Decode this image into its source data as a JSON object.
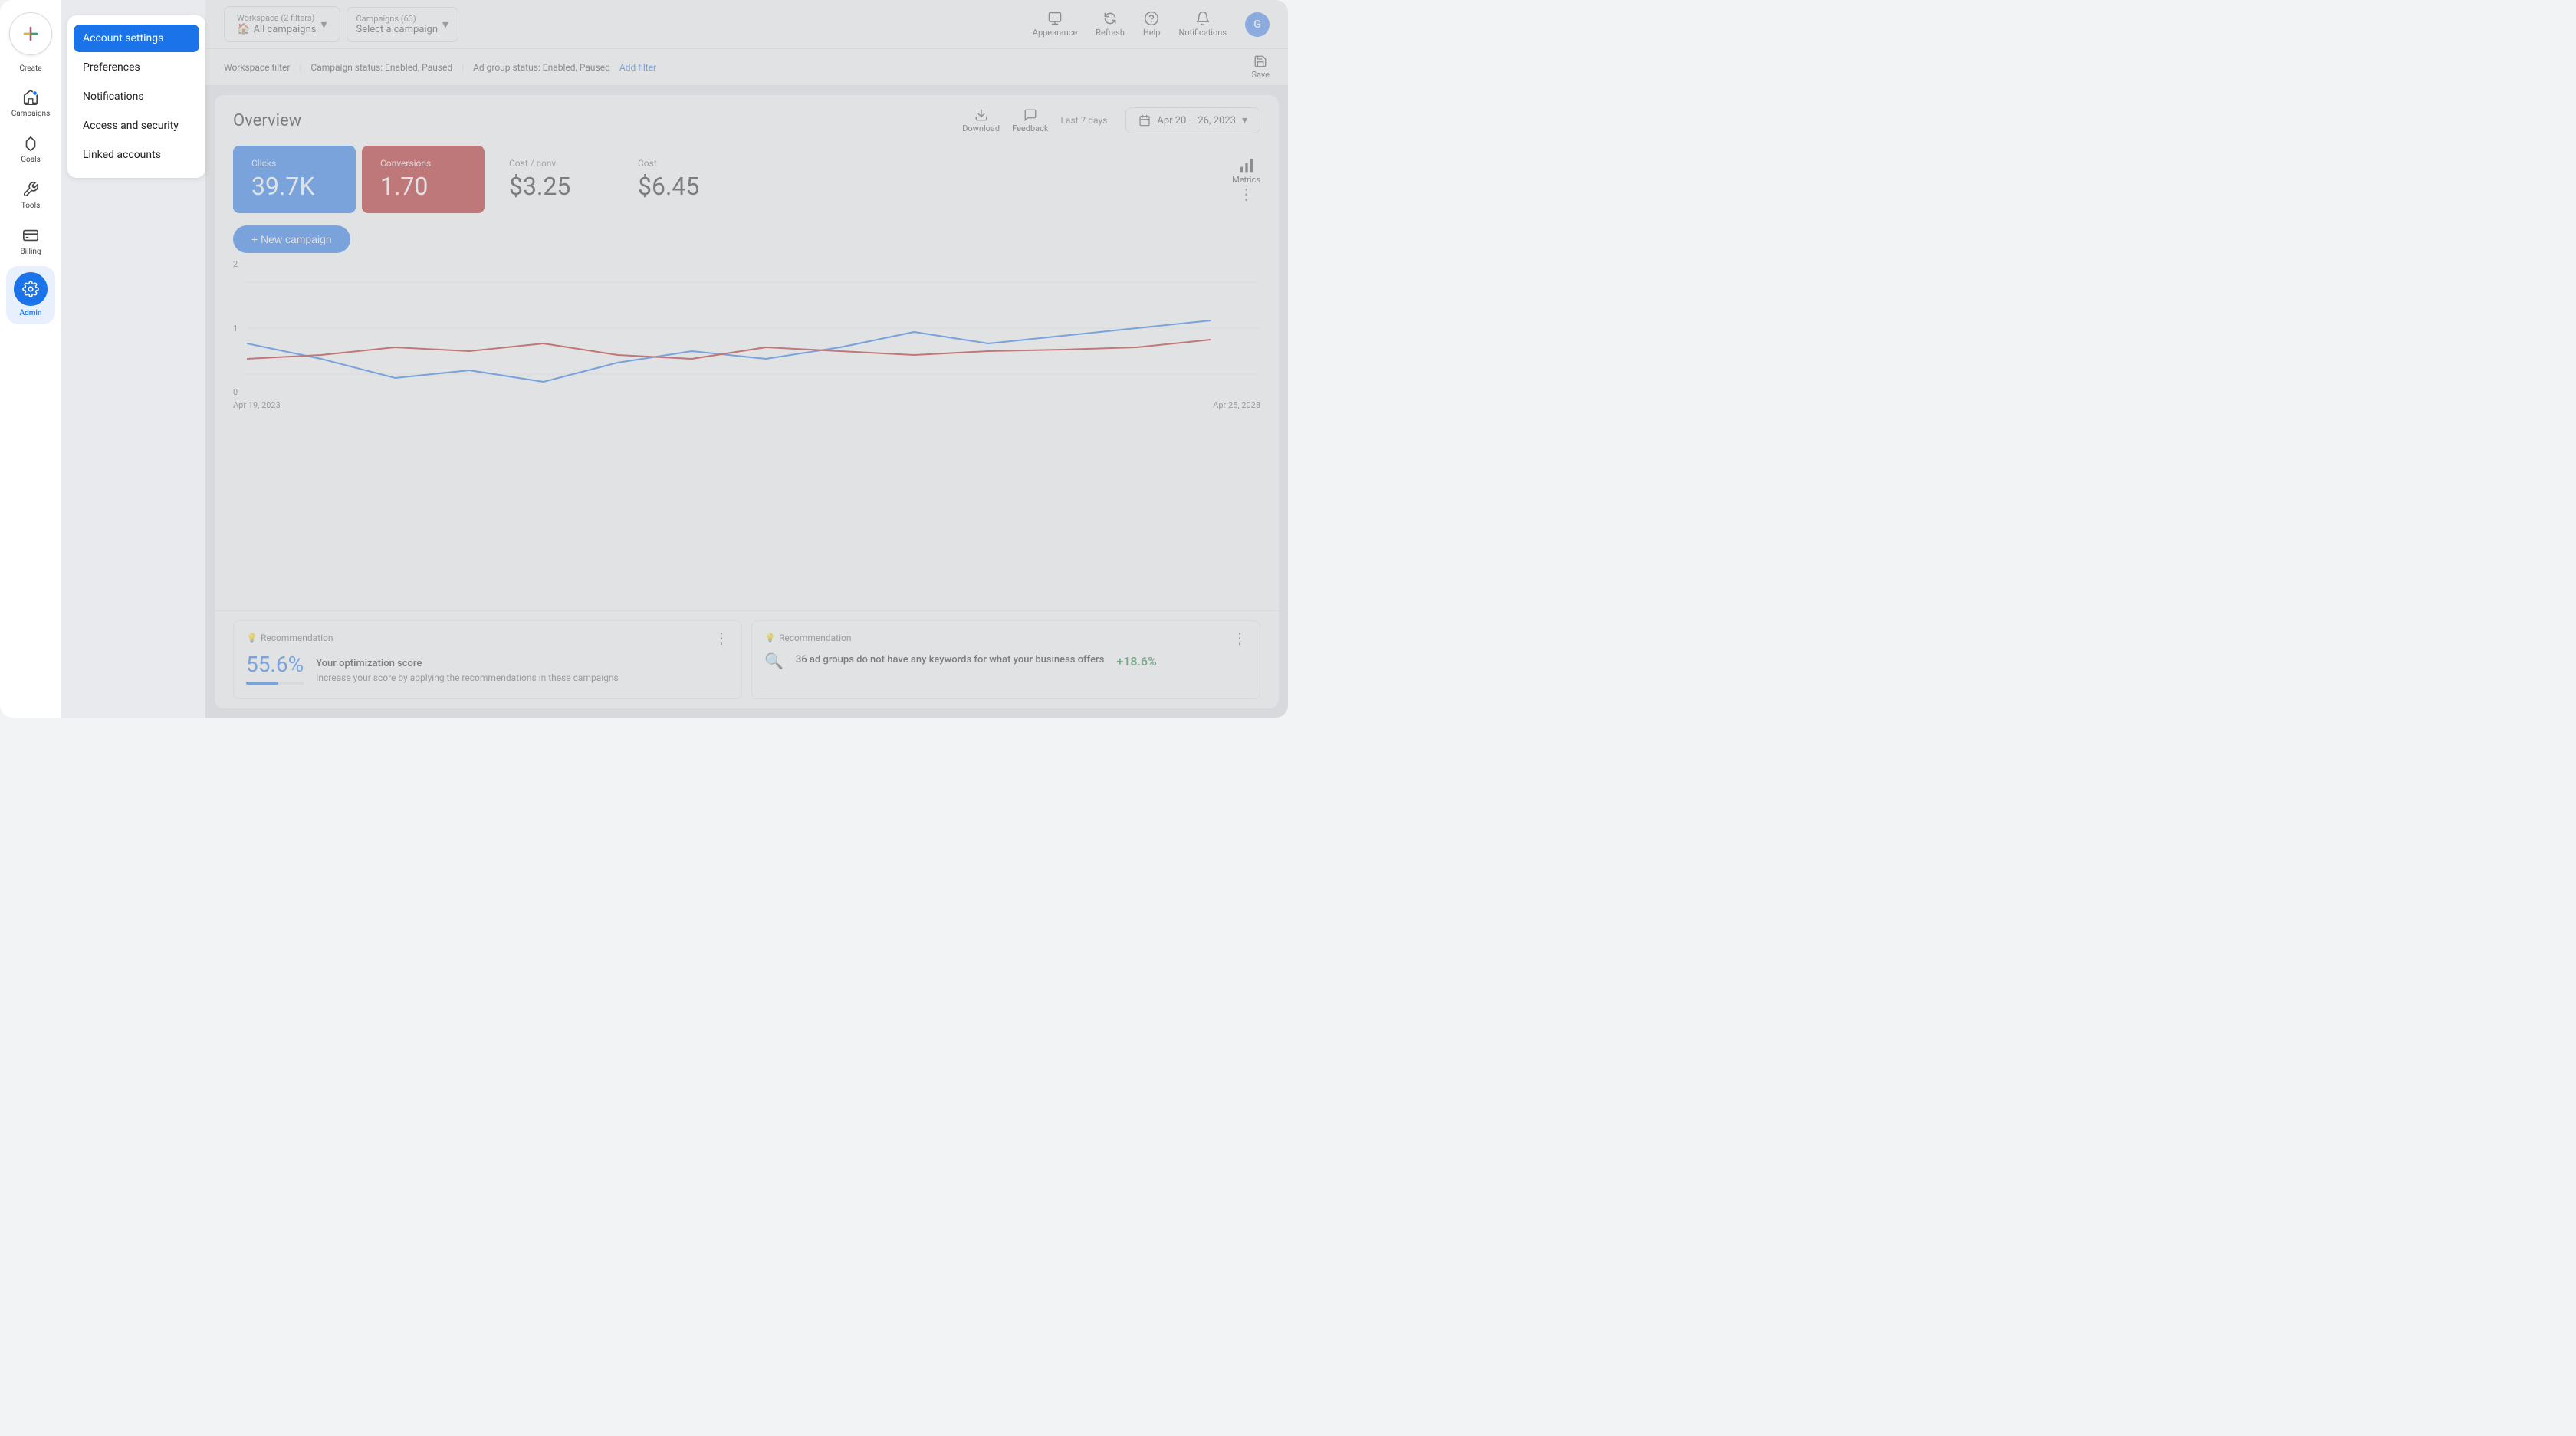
{
  "sidebar": {
    "create_label": "Create",
    "items": [
      {
        "id": "campaigns",
        "label": "Campaigns",
        "icon": "📢"
      },
      {
        "id": "goals",
        "label": "Goals",
        "icon": "🏆"
      },
      {
        "id": "tools",
        "label": "Tools",
        "icon": "🔧"
      },
      {
        "id": "billing",
        "label": "Billing",
        "icon": "💳"
      },
      {
        "id": "admin",
        "label": "Admin",
        "icon": "⚙️",
        "active": true
      }
    ]
  },
  "account_menu": {
    "items": [
      {
        "id": "account-settings",
        "label": "Account settings",
        "active": true
      },
      {
        "id": "preferences",
        "label": "Preferences"
      },
      {
        "id": "notifications",
        "label": "Notifications"
      },
      {
        "id": "access-security",
        "label": "Access and security"
      },
      {
        "id": "linked-accounts",
        "label": "Linked accounts"
      }
    ]
  },
  "toolbar": {
    "workspace_label": "Workspace (2 filters)",
    "workspace_sub": "All campaigns",
    "campaigns_label": "Campaigns (63)",
    "campaigns_sub": "Select a campaign",
    "appearance_label": "Appearance",
    "refresh_label": "Refresh",
    "help_label": "Help",
    "notifications_label": "Notifications",
    "save_label": "Save"
  },
  "filters": {
    "items": [
      "Workspace filter",
      "Campaign status: Enabled, Paused",
      "Ad group status: Enabled, Paused"
    ],
    "add_label": "Add filter"
  },
  "overview": {
    "title": "Overview",
    "last_days_label": "Last 7 days",
    "date_range": "Apr 20 – 26, 2023",
    "new_campaign_label": "+ New campaign",
    "download_label": "Download",
    "feedback_label": "Feedback",
    "metrics_label": "Metrics"
  },
  "metric_cards": [
    {
      "id": "clicks",
      "label": "Clicks",
      "value": "39.7K",
      "type": "blue"
    },
    {
      "id": "conversions",
      "label": "Conversions",
      "value": "1.70",
      "type": "red"
    },
    {
      "id": "cost-conv",
      "label": "Cost / conv.",
      "value": "$3.25",
      "type": "plain"
    },
    {
      "id": "cost",
      "label": "Cost",
      "value": "$6.45",
      "type": "plain"
    }
  ],
  "chart": {
    "y_labels": [
      "2",
      "1",
      "0"
    ],
    "x_labels": [
      "Apr 19, 2023",
      "Apr 25, 2023"
    ],
    "blue_line": [
      [
        0,
        110
      ],
      [
        60,
        130
      ],
      [
        120,
        155
      ],
      [
        180,
        145
      ],
      [
        240,
        160
      ],
      [
        300,
        135
      ],
      [
        360,
        120
      ],
      [
        420,
        130
      ],
      [
        480,
        115
      ],
      [
        540,
        95
      ],
      [
        600,
        110
      ],
      [
        660,
        100
      ],
      [
        720,
        90
      ],
      [
        780,
        80
      ]
    ],
    "red_line": [
      [
        0,
        130
      ],
      [
        60,
        125
      ],
      [
        120,
        115
      ],
      [
        180,
        120
      ],
      [
        240,
        110
      ],
      [
        300,
        125
      ],
      [
        360,
        130
      ],
      [
        420,
        115
      ],
      [
        480,
        120
      ],
      [
        540,
        125
      ],
      [
        600,
        120
      ],
      [
        660,
        118
      ],
      [
        720,
        115
      ],
      [
        780,
        105
      ]
    ]
  },
  "recommendations": [
    {
      "id": "opt-score",
      "label": "Recommendation",
      "score": "55.6%",
      "progress": 55.6,
      "title": "Your optimization score",
      "subtitle": "Increase your score by applying the recommendations in these campaigns"
    },
    {
      "id": "keywords",
      "label": "Recommendation",
      "icon": "search",
      "title": "36 ad groups do not have any keywords for what your business offers",
      "pct": "+18.6%"
    }
  ]
}
